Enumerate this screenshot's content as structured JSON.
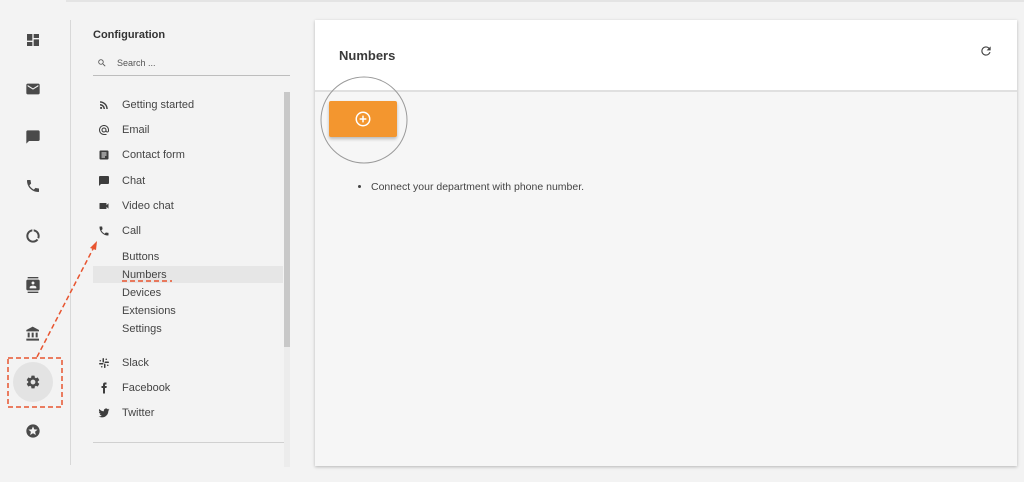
{
  "config": {
    "title": "Configuration",
    "search_placeholder": "Search ...",
    "nav": [
      {
        "label": "Getting started",
        "icon": "rss-icon"
      },
      {
        "label": "Email",
        "icon": "at-sign-icon"
      },
      {
        "label": "Contact form",
        "icon": "form-icon"
      },
      {
        "label": "Chat",
        "icon": "chat-bubble-icon"
      },
      {
        "label": "Video chat",
        "icon": "video-camera-icon"
      },
      {
        "label": "Call",
        "icon": "phone-icon"
      }
    ],
    "call_sub": [
      {
        "label": "Buttons"
      },
      {
        "label": "Numbers",
        "selected": true
      },
      {
        "label": "Devices"
      },
      {
        "label": "Extensions"
      },
      {
        "label": "Settings"
      }
    ],
    "nav_more": [
      {
        "label": "Slack",
        "icon": "slack-icon"
      },
      {
        "label": "Facebook",
        "icon": "facebook-icon"
      },
      {
        "label": "Twitter",
        "icon": "twitter-icon"
      }
    ]
  },
  "rail": [
    {
      "icon": "dashboard-icon"
    },
    {
      "icon": "mail-icon"
    },
    {
      "icon": "chat-icon"
    },
    {
      "icon": "phone-icon"
    },
    {
      "icon": "reports-icon"
    },
    {
      "icon": "contacts-icon"
    },
    {
      "icon": "bank-icon"
    },
    {
      "icon": "settings-gear-icon",
      "active": true
    },
    {
      "icon": "star-badge-icon"
    }
  ],
  "main": {
    "title": "Numbers",
    "help": [
      "Connect your department with phone number."
    ]
  },
  "colors": {
    "accent": "#f3962f",
    "annotation": "#e8542f"
  }
}
